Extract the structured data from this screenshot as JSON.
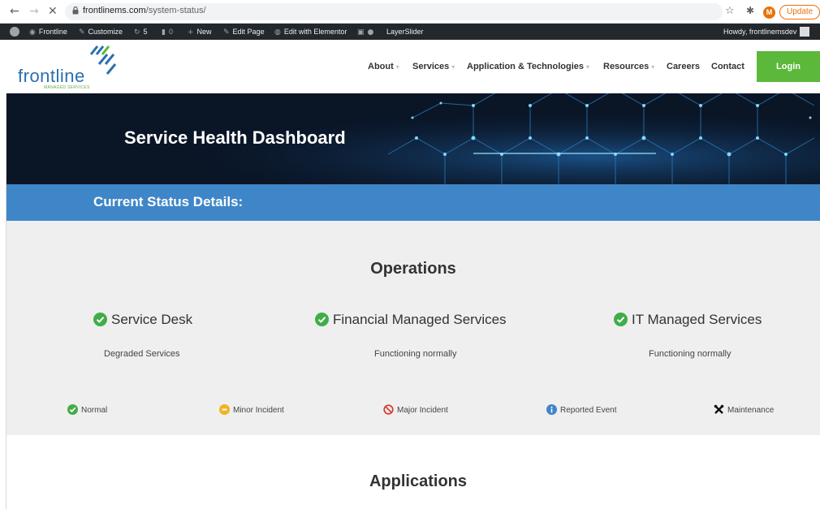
{
  "browser": {
    "url_domain": "frontlinems.com",
    "url_path": "/system-status/",
    "profile_initial": "M",
    "update_label": "Update"
  },
  "admin_bar": {
    "site_name": "Frontline",
    "customize": "Customize",
    "updates_count": "5",
    "comments_count": "0",
    "new_label": "New",
    "edit_page": "Edit Page",
    "edit_elementor": "Edit with Elementor",
    "layerslider": "LayerSlider",
    "howdy": "Howdy, frontlinemsdev"
  },
  "header": {
    "logo_text": "frontline",
    "logo_sub": "MANAGED SERVICES",
    "menu": [
      {
        "label": "About",
        "has_dropdown": true
      },
      {
        "label": "Services",
        "has_dropdown": true
      },
      {
        "label": "Application & Technologies",
        "has_dropdown": true
      },
      {
        "label": "Resources",
        "has_dropdown": true
      },
      {
        "label": "Careers",
        "has_dropdown": false
      },
      {
        "label": "Contact",
        "has_dropdown": false
      }
    ],
    "login_label": "Login",
    "login_color": "#5cb83a"
  },
  "hero": {
    "title": "Service Health Dashboard"
  },
  "status_bar": {
    "title": "Current Status Details:",
    "color": "#3f86c8"
  },
  "operations": {
    "heading": "Operations",
    "services": [
      {
        "name": "Service Desk",
        "status": "Degraded Services",
        "icon": "check-circle-icon"
      },
      {
        "name": "Financial Managed Services",
        "status": "Functioning normally",
        "icon": "check-circle-icon"
      },
      {
        "name": "IT Managed Services",
        "status": "Functioning normally",
        "icon": "check-circle-icon"
      }
    ],
    "legend": [
      {
        "label": "Normal",
        "icon": "check-circle-icon",
        "color": "#41ad49"
      },
      {
        "label": "Minor Incident",
        "icon": "minus-circle-icon",
        "color": "#f0b323"
      },
      {
        "label": "Major Incident",
        "icon": "prohibited-icon",
        "color": "#d9392e"
      },
      {
        "label": "Reported Event",
        "icon": "info-circle-icon",
        "color": "#3f86c8"
      },
      {
        "label": "Maintenance",
        "icon": "tools-icon",
        "color": "#111111"
      }
    ]
  },
  "applications": {
    "heading": "Applications"
  }
}
